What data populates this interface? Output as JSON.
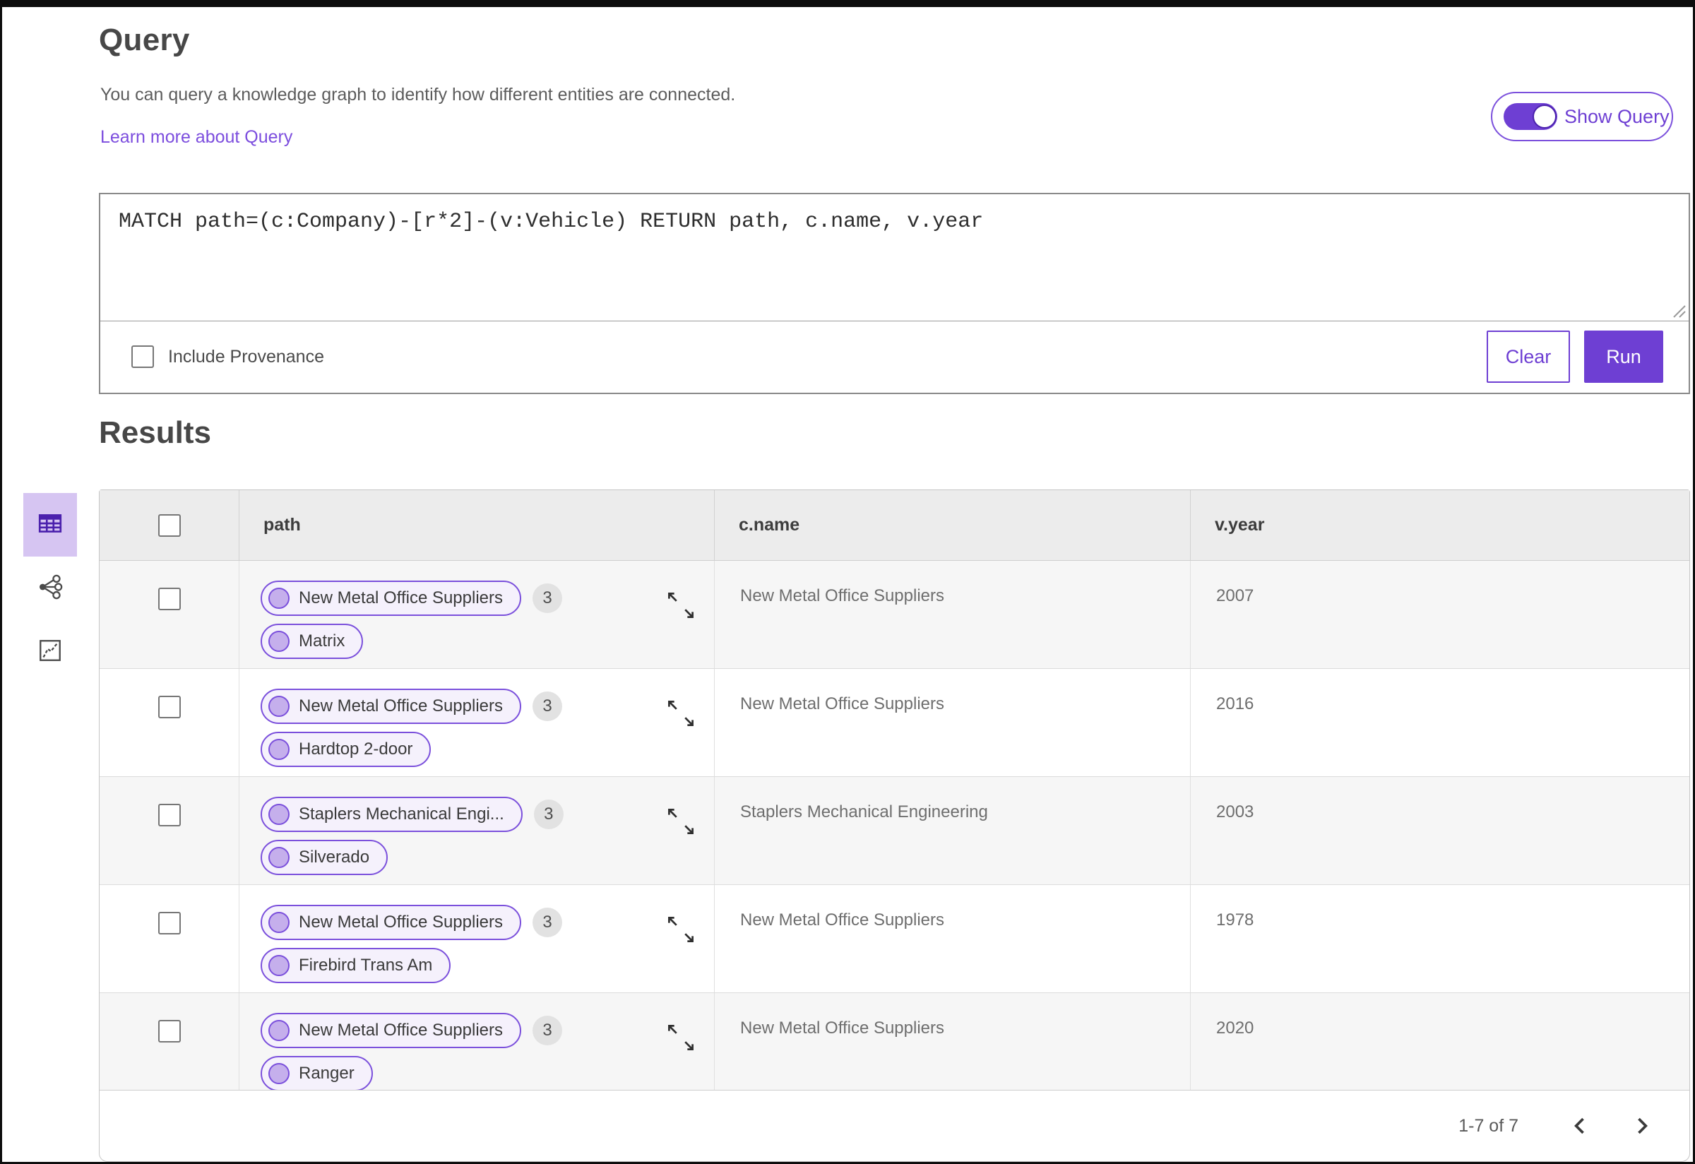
{
  "header": {
    "title": "Query",
    "description": "You can query a knowledge graph to identify how different entities are connected.",
    "learn_more_link": "Learn more about Query",
    "show_query_toggle": {
      "label": "Show Query",
      "state": "on"
    }
  },
  "query_editor": {
    "query_text": "MATCH path=(c:Company)-[r*2]-(v:Vehicle) RETURN path, c.name, v.year",
    "include_provenance": {
      "label": "Include Provenance",
      "checked": false
    },
    "buttons": {
      "clear": "Clear",
      "run": "Run"
    }
  },
  "results": {
    "title": "Results",
    "view_switcher": [
      {
        "name": "table-view",
        "selected": true
      },
      {
        "name": "graph-view",
        "selected": false
      },
      {
        "name": "chart-view",
        "selected": false
      }
    ],
    "table": {
      "columns": [
        "path",
        "c.name",
        "v.year"
      ],
      "rows": [
        {
          "pills": [
            {
              "label": "New Metal Office Suppliers",
              "count": "3"
            },
            {
              "label": "Matrix"
            }
          ],
          "c_name": "New Metal Office Suppliers",
          "v_year": "2007"
        },
        {
          "pills": [
            {
              "label": "New Metal Office Suppliers",
              "count": "3"
            },
            {
              "label": "Hardtop 2-door"
            }
          ],
          "c_name": "New Metal Office Suppliers",
          "v_year": "2016"
        },
        {
          "pills": [
            {
              "label": "Staplers Mechanical Engi...",
              "count": "3"
            },
            {
              "label": "Silverado"
            }
          ],
          "c_name": "Staplers Mechanical Engineering",
          "v_year": "2003"
        },
        {
          "pills": [
            {
              "label": "New Metal Office Suppliers",
              "count": "3"
            },
            {
              "label": "Firebird Trans Am"
            }
          ],
          "c_name": "New Metal Office Suppliers",
          "v_year": "1978"
        },
        {
          "pills": [
            {
              "label": "New Metal Office Suppliers",
              "count": "3"
            },
            {
              "label": "Ranger"
            }
          ],
          "c_name": "New Metal Office Suppliers",
          "v_year": "2020"
        }
      ],
      "pagination": {
        "range_label": "1-7 of 7"
      }
    }
  },
  "colors": {
    "primary_purple": "#6e3fd3",
    "pill_border": "#7b50dc",
    "pill_background": "#f5f1fc",
    "node_fill": "#c5afec",
    "selected_view_background": "#d6c5f2",
    "link": "#7c4dde",
    "table_header_background": "#ececec",
    "row_alternate_background": "#f6f6f6"
  }
}
